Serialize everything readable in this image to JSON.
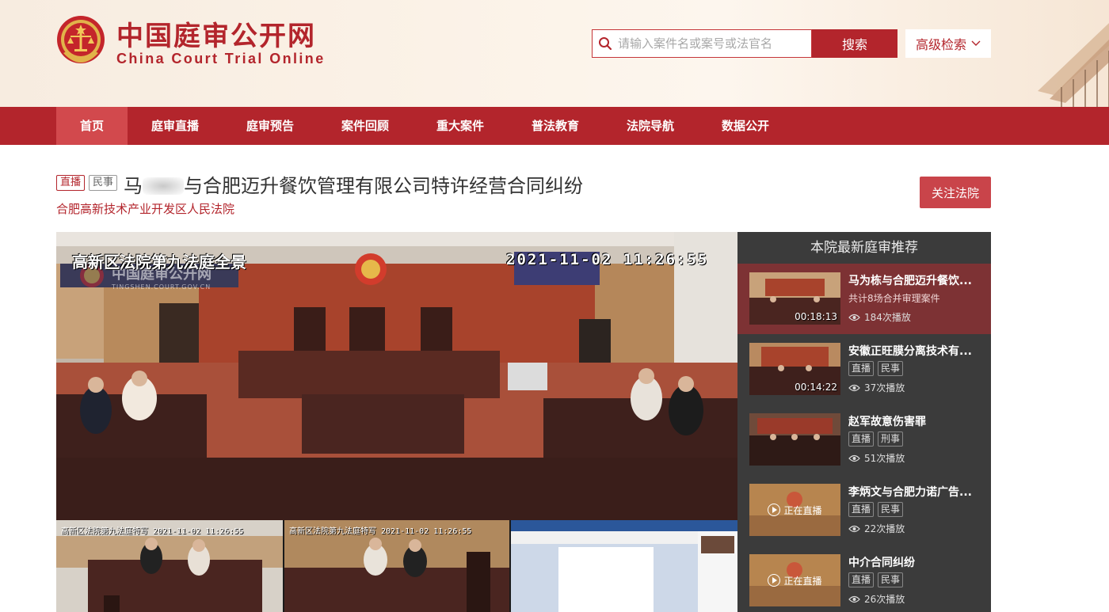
{
  "site": {
    "name_cn": "中国庭审公开网",
    "name_en": "China Court Trial Online"
  },
  "search": {
    "placeholder": "请输入案件名或案号或法官名",
    "button_label": "搜索",
    "advanced_label": "高级检索"
  },
  "nav": {
    "items": [
      {
        "label": "首页",
        "active": true
      },
      {
        "label": "庭审直播",
        "active": false
      },
      {
        "label": "庭审预告",
        "active": false
      },
      {
        "label": "案件回顾",
        "active": false
      },
      {
        "label": "重大案件",
        "active": false
      },
      {
        "label": "普法教育",
        "active": false
      },
      {
        "label": "法院导航",
        "active": false
      },
      {
        "label": "数据公开",
        "active": false
      }
    ]
  },
  "case": {
    "tag_live": "直播",
    "tag_type": "民事",
    "title_prefix": "马",
    "title_rest": "与合肥迈升餐饮管理有限公司特许经营合同纠纷",
    "court": "合肥高新技术产业开发区人民法院",
    "follow_label": "关注法院"
  },
  "video": {
    "overlay_title": "高新区法院第九法庭全景",
    "overlay_time": "2021-11-02  11:26:55",
    "watermark_cn": "中国庭审公开网",
    "watermark_en": "TINGSHEN.COURT.GOV.CN",
    "sub1_label": "高新区法院第九法庭特写  2021-11-02  11:26:55",
    "sub2_label": "高新区法院第九法庭特写  2021-11-02  11:26:55"
  },
  "sidebar": {
    "title": "本院最新庭审推荐",
    "items": [
      {
        "title": "马为栋与合肥迈升餐饮...",
        "sub": "共计8场合并审理案件",
        "duration": "00:18:13",
        "views": "184次播放",
        "tags": [],
        "live": false
      },
      {
        "title": "安徽正旺膜分离技术有...",
        "sub": "",
        "duration": "00:14:22",
        "views": "37次播放",
        "tags": [
          "直播",
          "民事"
        ],
        "live": false
      },
      {
        "title": "赵军故意伤害罪",
        "sub": "",
        "duration": "",
        "views": "51次播放",
        "tags": [
          "直播",
          "刑事"
        ],
        "live": false
      },
      {
        "title": "李炳文与合肥力诺广告...",
        "sub": "",
        "duration": "",
        "views": "22次播放",
        "tags": [
          "直播",
          "民事"
        ],
        "live": true
      },
      {
        "title": "中介合同纠纷",
        "sub": "",
        "duration": "",
        "views": "26次播放",
        "tags": [
          "直播",
          "民事"
        ],
        "live": true
      }
    ],
    "live_badge_label": "正在直播"
  },
  "colors": {
    "brand_red": "#b3252c",
    "nav_active": "#d2494d",
    "sidebar_bg": "#3b3b3b",
    "sidebar_active": "#7d3234"
  },
  "icons": {
    "search": "search-icon",
    "chevron": "chevron-down-icon",
    "views": "eye-icon",
    "play": "play-icon",
    "logo": "court-emblem-icon"
  }
}
